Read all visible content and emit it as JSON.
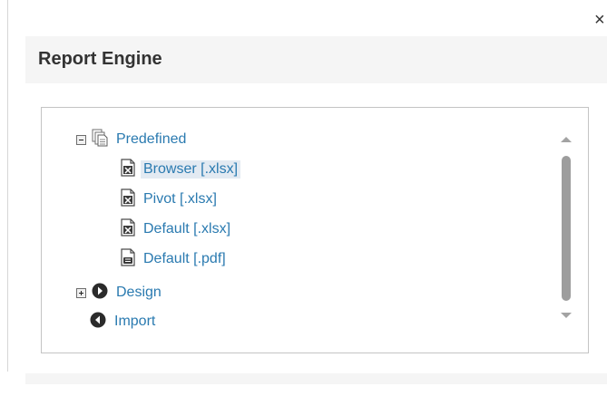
{
  "dialog": {
    "title": "Report Engine",
    "close_label": "×"
  },
  "tree": {
    "nodes": [
      {
        "label": "Predefined",
        "icon": "copy-pages-icon",
        "toggle": "minus"
      },
      {
        "label": "Browser [.xlsx]",
        "icon": "excel-file-icon",
        "selected": true
      },
      {
        "label": "Pivot [.xlsx]",
        "icon": "excel-file-icon"
      },
      {
        "label": "Default [.xlsx]",
        "icon": "excel-file-icon"
      },
      {
        "label": "Default [.pdf]",
        "icon": "pdf-file-icon"
      },
      {
        "label": "Design",
        "icon": "circle-arrow-right-icon",
        "toggle": "plus"
      },
      {
        "label": "Import",
        "icon": "circle-arrow-left-icon"
      }
    ]
  },
  "colors": {
    "link": "#2a7ab0",
    "selected_bg": "#e3eaf2",
    "header_bg": "#f5f5f5"
  }
}
